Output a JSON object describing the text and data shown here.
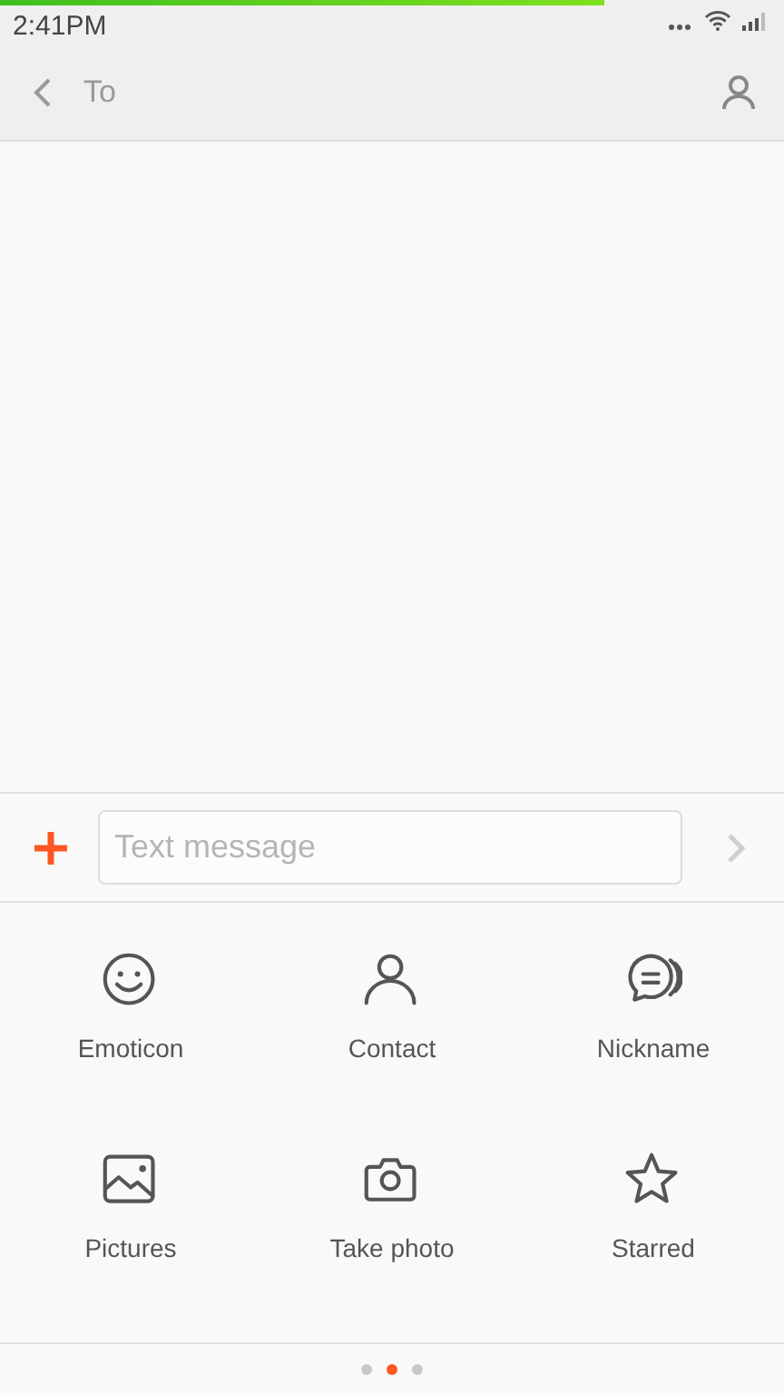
{
  "status_bar": {
    "time": "2:41PM",
    "progress": {
      "level": 0.77
    }
  },
  "header": {
    "title": "To"
  },
  "composer": {
    "placeholder": "Text message"
  },
  "attachments": [
    {
      "kind": "emoticon",
      "label": "Emoticon"
    },
    {
      "kind": "contact",
      "label": "Contact"
    },
    {
      "kind": "nickname",
      "label": "Nickname"
    },
    {
      "kind": "pictures",
      "label": "Pictures"
    },
    {
      "kind": "camera",
      "label": "Take photo"
    },
    {
      "kind": "star",
      "label": "Starred"
    }
  ],
  "pages": [
    {
      "selected": false
    },
    {
      "selected": true
    },
    {
      "selected": false
    }
  ]
}
